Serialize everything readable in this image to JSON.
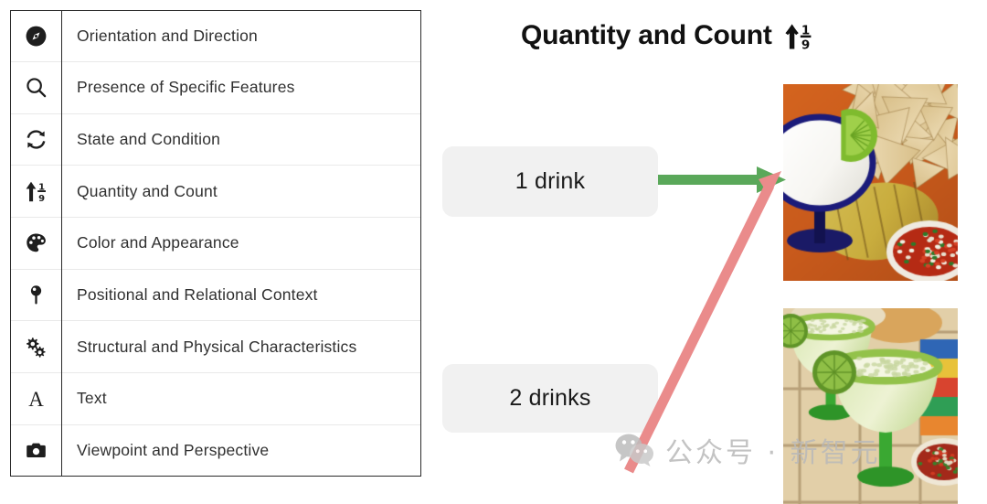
{
  "table": {
    "rows": [
      {
        "icon": "compass-icon",
        "label": "Orientation and Direction"
      },
      {
        "icon": "magnifier-icon",
        "label": "Presence of Specific Features"
      },
      {
        "icon": "sync-refresh-icon",
        "label": "State and Condition"
      },
      {
        "icon": "sort-numeric-up-icon",
        "label": "Quantity and Count"
      },
      {
        "icon": "palette-icon",
        "label": "Color and Appearance"
      },
      {
        "icon": "map-pin-icon",
        "label": "Positional and Relational Context"
      },
      {
        "icon": "gears-icon",
        "label": "Structural and Physical Characteristics"
      },
      {
        "icon": "letter-a-icon",
        "label": "Text"
      },
      {
        "icon": "camera-icon",
        "label": "Viewpoint and Perspective"
      }
    ]
  },
  "panel": {
    "title": "Quantity and Count",
    "title_icon": "sort-numeric-up-icon",
    "captions": [
      {
        "text": "1 drink",
        "arrow_color": "#5aa85a",
        "arrow_name": "green-arrow"
      },
      {
        "text": "2 drinks",
        "arrow_color": "#ea8b8b",
        "arrow_name": "pink-arrow"
      }
    ],
    "photos": [
      {
        "name": "photo-margarita-with-chips",
        "alt": "White margarita with lime wedge beside tortilla chips and salsa"
      },
      {
        "name": "photo-two-green-margaritas",
        "alt": "Two green margarita glasses on a tiled table"
      }
    ]
  },
  "watermark": {
    "icon": "wechat-icon",
    "text": "公众号 · 新智元"
  },
  "colors": {
    "green_arrow": "#5aa85a",
    "pink_arrow": "#ea8b8b",
    "pill_background": "#f1f1f1",
    "table_border": "#2b2b2b",
    "row_divider": "#e9e9e9",
    "text": "#303030",
    "watermark": "#b9b9b9"
  }
}
